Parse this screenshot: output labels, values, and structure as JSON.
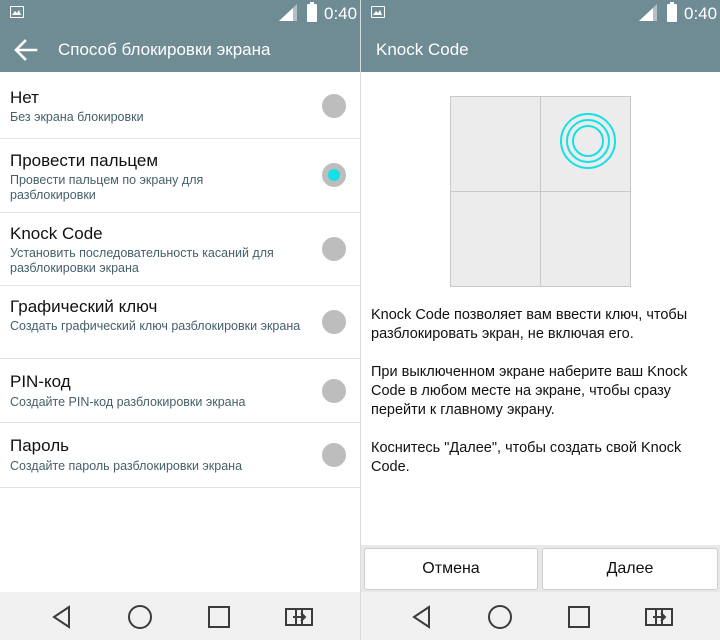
{
  "status_bar": {
    "time": "0:40",
    "icons": [
      "image-icon",
      "signal-icon",
      "battery-icon"
    ]
  },
  "colors": {
    "header": "#6f8c95",
    "accent": "#14e1e6",
    "radio_off": "#bdbdbd",
    "subtitle": "#46606a"
  },
  "lock_screen_settings": {
    "title": "Способ блокировки экрана",
    "options": [
      {
        "title": "Нет",
        "subtitle": "Без экрана блокировки",
        "selected": false
      },
      {
        "title": "Провести пальцем",
        "subtitle": "Провести пальцем по экрану для разблокировки",
        "selected": true
      },
      {
        "title": "Knock Code",
        "subtitle": "Установить последовательность касаний для разблокировки экрана",
        "selected": false
      },
      {
        "title": "Графический ключ",
        "subtitle": "Создать графический ключ разблокировки экрана",
        "selected": false
      },
      {
        "title": "PIN-код",
        "subtitle": "Создайте PIN-код разблокировки экрана",
        "selected": false
      },
      {
        "title": "Пароль",
        "subtitle": "Создайте пароль разблокировки экрана",
        "selected": false
      }
    ]
  },
  "knock_code": {
    "title": "Knock Code",
    "paragraphs": [
      "Knock Code позволяет вам ввести ключ, чтобы разблокировать экран, не включая его.",
      "При выключенном экране наберите ваш Knock Code в любом месте на экране, чтобы сразу перейти к главному экрану.",
      "Коснитесь \"Далее\", чтобы создать свой Knock Code."
    ],
    "cancel_label": "Отмена",
    "next_label": "Далее",
    "active_quadrant": "top-right"
  },
  "nav_bar": {
    "icons": [
      "back-icon",
      "home-icon",
      "recents-icon",
      "dual-window-icon"
    ]
  }
}
